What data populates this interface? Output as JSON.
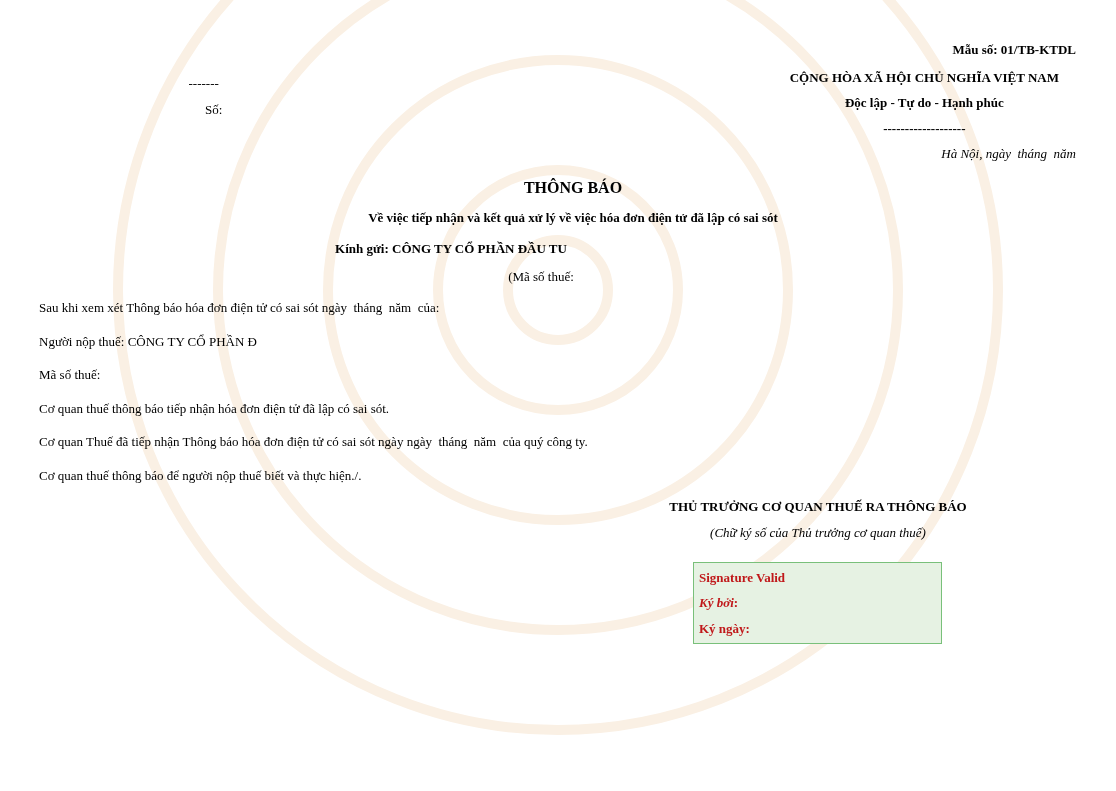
{
  "header_left": {
    "rule": "-------",
    "number_label": "Số:"
  },
  "header_right": {
    "form_number": "Mẫu số: 01/TB-KTDL",
    "country": "CỘNG HÒA XÃ HỘI CHỦ NGHĨA VIỆT NAM",
    "motto": "Độc lập - Tự do - Hạnh phúc",
    "rule": "-------------------",
    "place_date": "Hà Nội, ngày  tháng  năm"
  },
  "title": "THÔNG BÁO",
  "subtitle": "Về việc tiếp nhận và kết quả xử lý về việc hóa đơn điện tử đã lập có sai sót",
  "recipient": "Kính gửi: CÔNG TY CỔ PHẦN ĐẦU TU",
  "recipient_tax_code": "(Mã số thuế:",
  "paragraphs": [
    "Sau khi xem xét Thông báo hóa đơn điện tử có sai sót ngày  tháng  năm  của:",
    "Người nộp thuế: CÔNG TY CỔ PHẦN Đ",
    "Mã số thuế:",
    "Cơ quan thuế thông báo tiếp nhận hóa đơn điện tử đã lập có sai sót.",
    "Cơ quan Thuế đã tiếp nhận Thông báo hóa đơn điện tử có sai sót ngày ngày  tháng  năm  của quý công ty.",
    "Cơ quan thuế thông báo để người nộp thuế biết và thực hiện./."
  ],
  "signer": {
    "title": "THỦ TRƯỞNG CƠ QUAN THUẾ RA THÔNG BÁO",
    "note": "(Chữ ký số của Thủ trưởng cơ quan thuế)"
  },
  "signature_box": {
    "status": "Signature Valid",
    "signed_by": "*Ký bởi*:",
    "signed_date": "Ký ngày:"
  }
}
